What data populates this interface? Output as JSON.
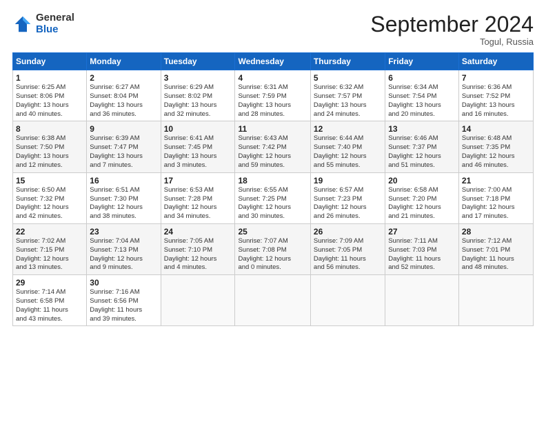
{
  "header": {
    "logo_general": "General",
    "logo_blue": "Blue",
    "month_title": "September 2024",
    "location": "Togul, Russia"
  },
  "days_of_week": [
    "Sunday",
    "Monday",
    "Tuesday",
    "Wednesday",
    "Thursday",
    "Friday",
    "Saturday"
  ],
  "weeks": [
    [
      {
        "day": "1",
        "info": "Sunrise: 6:25 AM\nSunset: 8:06 PM\nDaylight: 13 hours\nand 40 minutes."
      },
      {
        "day": "2",
        "info": "Sunrise: 6:27 AM\nSunset: 8:04 PM\nDaylight: 13 hours\nand 36 minutes."
      },
      {
        "day": "3",
        "info": "Sunrise: 6:29 AM\nSunset: 8:02 PM\nDaylight: 13 hours\nand 32 minutes."
      },
      {
        "day": "4",
        "info": "Sunrise: 6:31 AM\nSunset: 7:59 PM\nDaylight: 13 hours\nand 28 minutes."
      },
      {
        "day": "5",
        "info": "Sunrise: 6:32 AM\nSunset: 7:57 PM\nDaylight: 13 hours\nand 24 minutes."
      },
      {
        "day": "6",
        "info": "Sunrise: 6:34 AM\nSunset: 7:54 PM\nDaylight: 13 hours\nand 20 minutes."
      },
      {
        "day": "7",
        "info": "Sunrise: 6:36 AM\nSunset: 7:52 PM\nDaylight: 13 hours\nand 16 minutes."
      }
    ],
    [
      {
        "day": "8",
        "info": "Sunrise: 6:38 AM\nSunset: 7:50 PM\nDaylight: 13 hours\nand 12 minutes."
      },
      {
        "day": "9",
        "info": "Sunrise: 6:39 AM\nSunset: 7:47 PM\nDaylight: 13 hours\nand 7 minutes."
      },
      {
        "day": "10",
        "info": "Sunrise: 6:41 AM\nSunset: 7:45 PM\nDaylight: 13 hours\nand 3 minutes."
      },
      {
        "day": "11",
        "info": "Sunrise: 6:43 AM\nSunset: 7:42 PM\nDaylight: 12 hours\nand 59 minutes."
      },
      {
        "day": "12",
        "info": "Sunrise: 6:44 AM\nSunset: 7:40 PM\nDaylight: 12 hours\nand 55 minutes."
      },
      {
        "day": "13",
        "info": "Sunrise: 6:46 AM\nSunset: 7:37 PM\nDaylight: 12 hours\nand 51 minutes."
      },
      {
        "day": "14",
        "info": "Sunrise: 6:48 AM\nSunset: 7:35 PM\nDaylight: 12 hours\nand 46 minutes."
      }
    ],
    [
      {
        "day": "15",
        "info": "Sunrise: 6:50 AM\nSunset: 7:32 PM\nDaylight: 12 hours\nand 42 minutes."
      },
      {
        "day": "16",
        "info": "Sunrise: 6:51 AM\nSunset: 7:30 PM\nDaylight: 12 hours\nand 38 minutes."
      },
      {
        "day": "17",
        "info": "Sunrise: 6:53 AM\nSunset: 7:28 PM\nDaylight: 12 hours\nand 34 minutes."
      },
      {
        "day": "18",
        "info": "Sunrise: 6:55 AM\nSunset: 7:25 PM\nDaylight: 12 hours\nand 30 minutes."
      },
      {
        "day": "19",
        "info": "Sunrise: 6:57 AM\nSunset: 7:23 PM\nDaylight: 12 hours\nand 26 minutes."
      },
      {
        "day": "20",
        "info": "Sunrise: 6:58 AM\nSunset: 7:20 PM\nDaylight: 12 hours\nand 21 minutes."
      },
      {
        "day": "21",
        "info": "Sunrise: 7:00 AM\nSunset: 7:18 PM\nDaylight: 12 hours\nand 17 minutes."
      }
    ],
    [
      {
        "day": "22",
        "info": "Sunrise: 7:02 AM\nSunset: 7:15 PM\nDaylight: 12 hours\nand 13 minutes."
      },
      {
        "day": "23",
        "info": "Sunrise: 7:04 AM\nSunset: 7:13 PM\nDaylight: 12 hours\nand 9 minutes."
      },
      {
        "day": "24",
        "info": "Sunrise: 7:05 AM\nSunset: 7:10 PM\nDaylight: 12 hours\nand 4 minutes."
      },
      {
        "day": "25",
        "info": "Sunrise: 7:07 AM\nSunset: 7:08 PM\nDaylight: 12 hours\nand 0 minutes."
      },
      {
        "day": "26",
        "info": "Sunrise: 7:09 AM\nSunset: 7:05 PM\nDaylight: 11 hours\nand 56 minutes."
      },
      {
        "day": "27",
        "info": "Sunrise: 7:11 AM\nSunset: 7:03 PM\nDaylight: 11 hours\nand 52 minutes."
      },
      {
        "day": "28",
        "info": "Sunrise: 7:12 AM\nSunset: 7:01 PM\nDaylight: 11 hours\nand 48 minutes."
      }
    ],
    [
      {
        "day": "29",
        "info": "Sunrise: 7:14 AM\nSunset: 6:58 PM\nDaylight: 11 hours\nand 43 minutes."
      },
      {
        "day": "30",
        "info": "Sunrise: 7:16 AM\nSunset: 6:56 PM\nDaylight: 11 hours\nand 39 minutes."
      },
      {
        "day": "",
        "info": ""
      },
      {
        "day": "",
        "info": ""
      },
      {
        "day": "",
        "info": ""
      },
      {
        "day": "",
        "info": ""
      },
      {
        "day": "",
        "info": ""
      }
    ]
  ]
}
